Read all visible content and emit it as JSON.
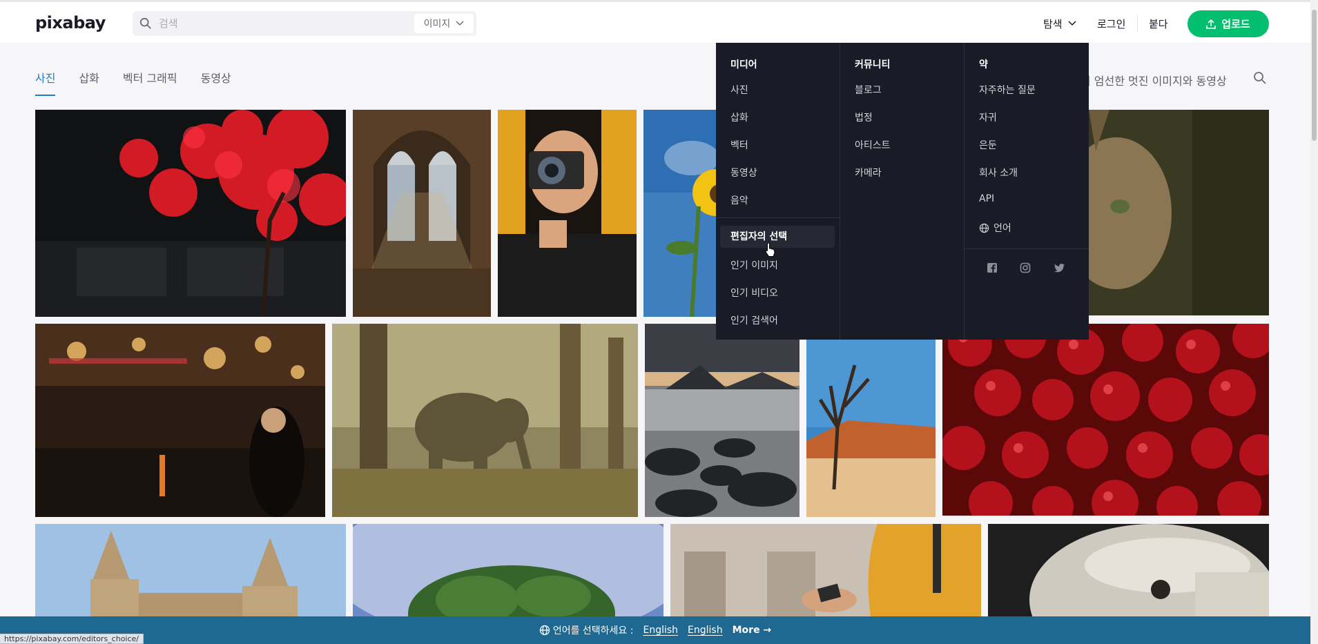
{
  "header": {
    "logo": "pixabay",
    "search_placeholder": "검색",
    "search_type": "이미지",
    "explore": "탐색",
    "login": "로그인",
    "join": "붙다",
    "upload": "업로드"
  },
  "tabs": [
    {
      "label": "사진",
      "active": true
    },
    {
      "label": "삽화",
      "active": false
    },
    {
      "label": "벡터 그래픽",
      "active": false
    },
    {
      "label": "동영상",
      "active": false
    }
  ],
  "tagline": "이 엄선한 멋진 이미지와 동영상",
  "menu": {
    "media": {
      "heading": "미디어",
      "items": [
        "사진",
        "삽화",
        "벡터",
        "동영상",
        "음악"
      ],
      "featured": [
        "편집자의 선택",
        "인기 이미지",
        "인기 비디오",
        "인기 검색어"
      ]
    },
    "community": {
      "heading": "커뮤니티",
      "items": [
        "블로그",
        "법정",
        "아티스트",
        "카메라"
      ]
    },
    "about": {
      "heading": "약",
      "items": [
        "자주하는 질문",
        "자귀",
        "은둔",
        "회사 소개",
        "API",
        "언어"
      ]
    },
    "social_icons": [
      "facebook-icon",
      "instagram-icon",
      "twitter-icon"
    ]
  },
  "banner": {
    "prompt": "언어를 선택하세요 :",
    "lang1": "English",
    "lang2": "English",
    "more": "More →"
  },
  "status_url": "https://pixabay.com/editors_choice/",
  "colors": {
    "accent": "#1d80c6",
    "upload": "#02be6e",
    "menu_bg": "#191b26",
    "banner_bg": "#1f6892"
  }
}
